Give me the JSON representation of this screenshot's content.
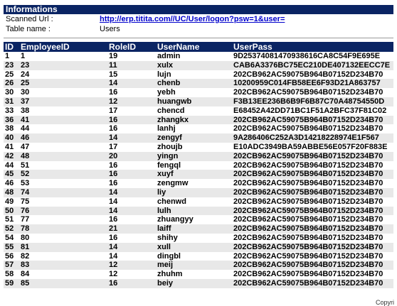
{
  "informations": {
    "title": "Informations",
    "scanned_url_label": "Scanned Url :",
    "scanned_url": "http://erp.titita.com//UC/User/logon?psw=1&user=",
    "table_name_label": "Table name :",
    "table_name": "Users"
  },
  "table": {
    "headers": [
      "ID",
      "EmployeeID",
      "RoleID",
      "UserName",
      "UserPass"
    ],
    "rows": [
      [
        "1",
        "1",
        "19",
        "admin",
        "9D25374081470938616CA8C54F9E695E"
      ],
      [
        "23",
        "23",
        "11",
        "xulx",
        "CAB6A3376BC75EC210DE407132EECC7E"
      ],
      [
        "25",
        "24",
        "15",
        "lujn",
        "202CB962AC59075B964B07152D234B70"
      ],
      [
        "26",
        "25",
        "14",
        "chenb",
        "10200959C014FB58EE6F93D21A863757"
      ],
      [
        "30",
        "30",
        "16",
        "yebh",
        "202CB962AC59075B964B07152D234B70"
      ],
      [
        "31",
        "37",
        "12",
        "huangwb",
        "F3B13EE236B6B9F6B87C70A48754550D"
      ],
      [
        "33",
        "38",
        "17",
        "chencd",
        "E68452A42DD71BC1F51A2BFC37F81C02"
      ],
      [
        "36",
        "41",
        "16",
        "zhangkx",
        "202CB962AC59075B964B07152D234B70"
      ],
      [
        "38",
        "44",
        "16",
        "lanhj",
        "202CB962AC59075B964B07152D234B70"
      ],
      [
        "40",
        "46",
        "14",
        "zengyf",
        "9A286406C252A3D14218228974E1F567"
      ],
      [
        "41",
        "47",
        "17",
        "zhoujb",
        "E10ADC3949BA59ABBE56E057F20F883E"
      ],
      [
        "42",
        "48",
        "20",
        "yingn",
        "202CB962AC59075B964B07152D234B70"
      ],
      [
        "44",
        "51",
        "16",
        "fengql",
        "202CB962AC59075B964B07152D234B70"
      ],
      [
        "45",
        "52",
        "16",
        "xuyf",
        "202CB962AC59075B964B07152D234B70"
      ],
      [
        "46",
        "53",
        "16",
        "zengmw",
        "202CB962AC59075B964B07152D234B70"
      ],
      [
        "48",
        "74",
        "14",
        "liy",
        "202CB962AC59075B964B07152D234B70"
      ],
      [
        "49",
        "75",
        "14",
        "chenwd",
        "202CB962AC59075B964B07152D234B70"
      ],
      [
        "50",
        "76",
        "14",
        "lulh",
        "202CB962AC59075B964B07152D234B70"
      ],
      [
        "51",
        "77",
        "16",
        "zhuangyy",
        "202CB962AC59075B964B07152D234B70"
      ],
      [
        "52",
        "78",
        "21",
        "laiff",
        "202CB962AC59075B964B07152D234B70"
      ],
      [
        "54",
        "80",
        "16",
        "shihy",
        "202CB962AC59075B964B07152D234B70"
      ],
      [
        "55",
        "81",
        "14",
        "xull",
        "202CB962AC59075B964B07152D234B70"
      ],
      [
        "56",
        "82",
        "14",
        "dingbl",
        "202CB962AC59075B964B07152D234B70"
      ],
      [
        "57",
        "83",
        "12",
        "meij",
        "202CB962AC59075B964B07152D234B70"
      ],
      [
        "58",
        "84",
        "12",
        "zhuhm",
        "202CB962AC59075B964B07152D234B70"
      ],
      [
        "59",
        "85",
        "16",
        "beiy",
        "202CB962AC59075B964B07152D234B70"
      ]
    ]
  },
  "footer": {
    "text": "Copyri"
  },
  "colors": {
    "header_bg": "#0a2463",
    "link": "#0000cc",
    "row_alt": "#e8e8e8"
  }
}
